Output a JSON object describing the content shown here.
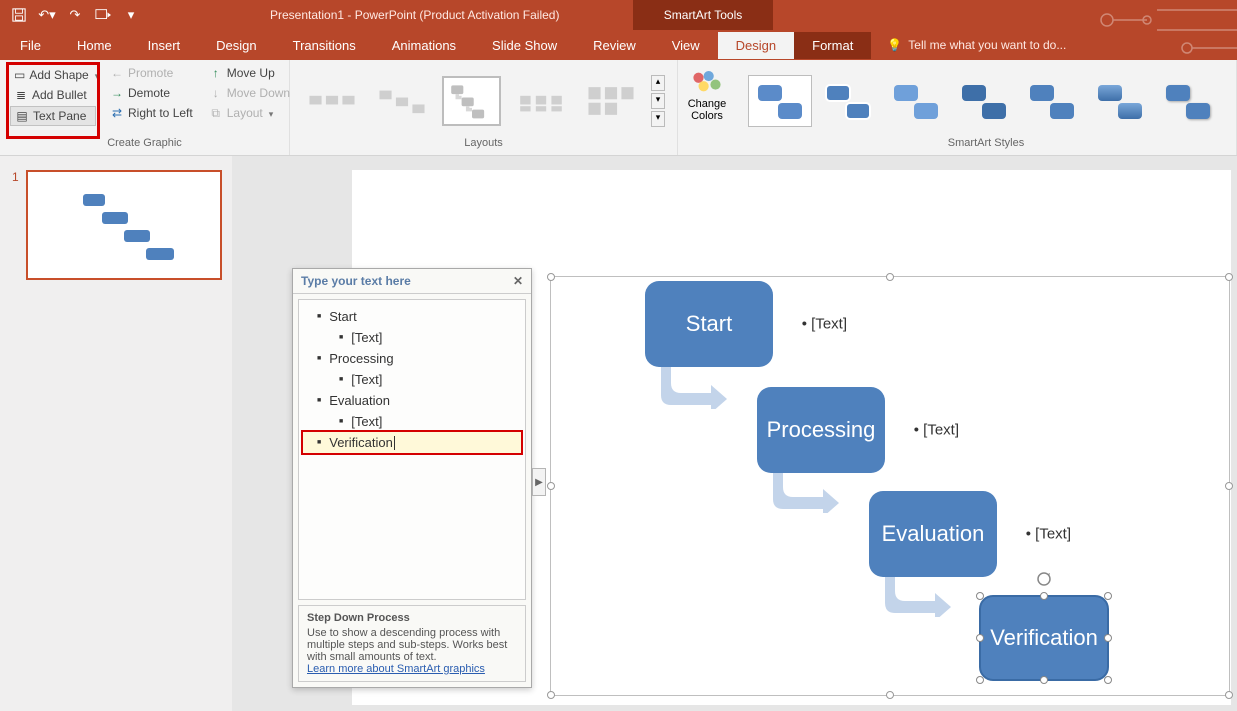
{
  "title": "Presentation1 - PowerPoint (Product Activation Failed)",
  "smartartToolsLabel": "SmartArt Tools",
  "tabs": {
    "file": "File",
    "home": "Home",
    "insert": "Insert",
    "design0": "Design",
    "transitions": "Transitions",
    "animations": "Animations",
    "slideshow": "Slide Show",
    "review": "Review",
    "view": "View",
    "design": "Design",
    "format": "Format",
    "tellme": "Tell me what you want to do..."
  },
  "ribbon": {
    "createGraphic": {
      "label": "Create Graphic",
      "addShape": "Add Shape",
      "addBullet": "Add Bullet",
      "textPane": "Text Pane",
      "promote": "Promote",
      "demote": "Demote",
      "rtl": "Right to Left",
      "moveUp": "Move Up",
      "moveDown": "Move Down",
      "layout": "Layout"
    },
    "layouts": {
      "label": "Layouts"
    },
    "changeColors": "Change Colors",
    "styles": {
      "label": "SmartArt Styles"
    }
  },
  "slides": {
    "num": "1"
  },
  "textPane": {
    "title": "Type your text here",
    "items": [
      {
        "level": 1,
        "text": "Start"
      },
      {
        "level": 2,
        "text": "[Text]"
      },
      {
        "level": 1,
        "text": "Processing"
      },
      {
        "level": 2,
        "text": "[Text]"
      },
      {
        "level": 1,
        "text": "Evaluation"
      },
      {
        "level": 2,
        "text": "[Text]"
      },
      {
        "level": 1,
        "text": "Verification",
        "hl": true
      }
    ],
    "footTitle": "Step Down Process",
    "footDesc": "Use to show a descending process with multiple steps and sub-steps. Works best with small amounts of text.",
    "footLink": "Learn more about SmartArt graphics"
  },
  "smartart": {
    "steps": [
      {
        "label": "Start",
        "sub": "• [Text]"
      },
      {
        "label": "Processing",
        "sub": "• [Text]"
      },
      {
        "label": "Evaluation",
        "sub": "• [Text]"
      },
      {
        "label": "Verification"
      }
    ]
  }
}
